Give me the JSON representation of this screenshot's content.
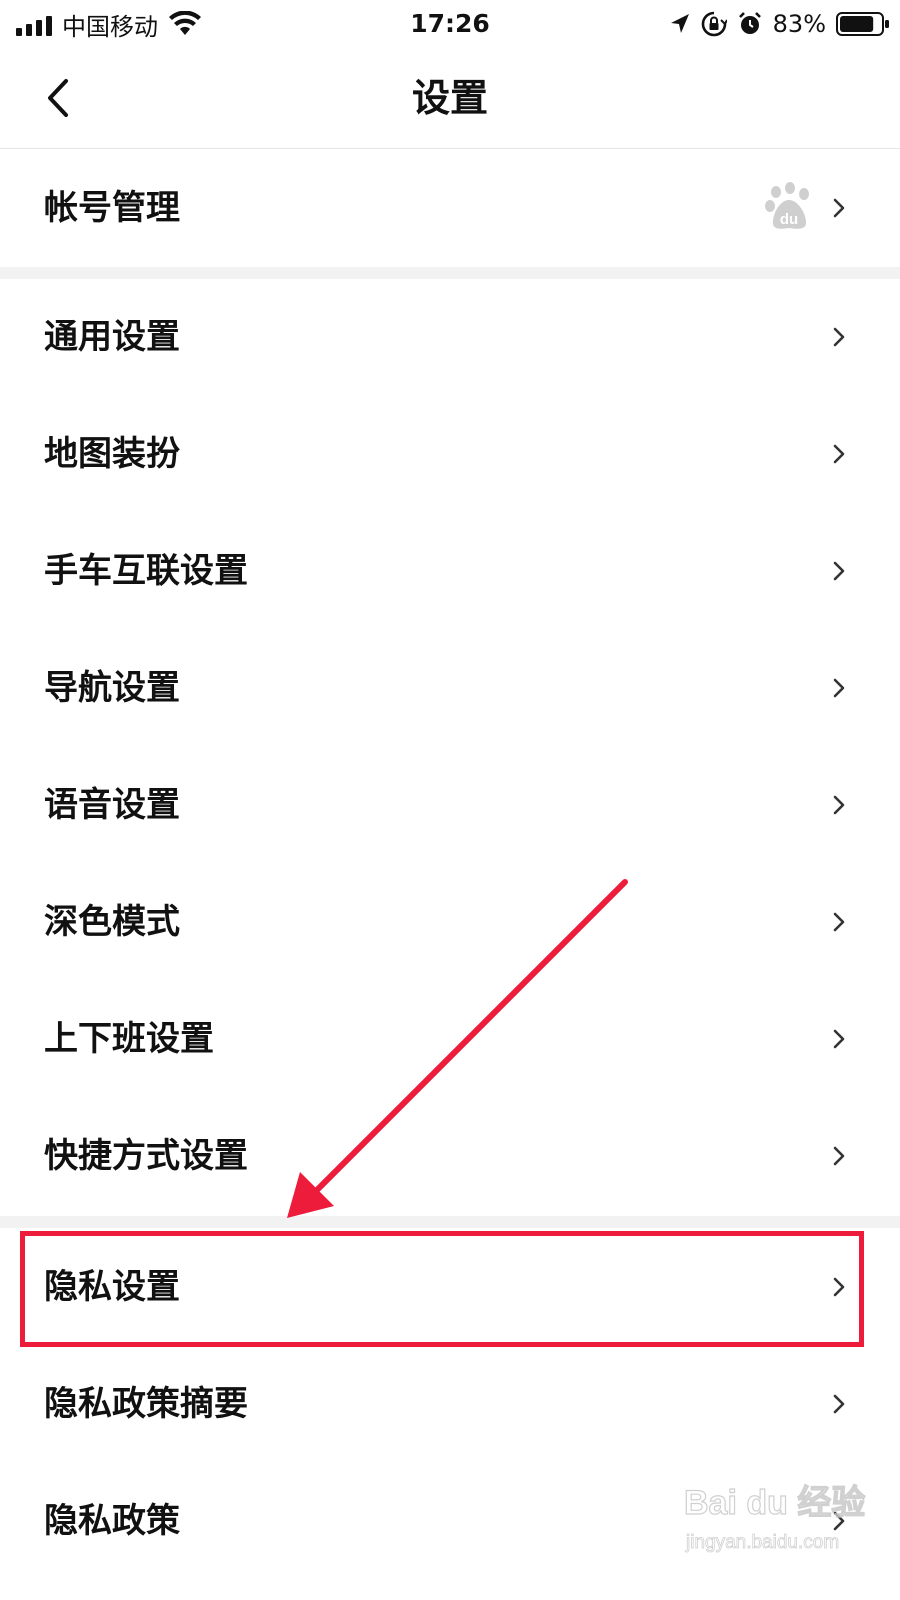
{
  "status_bar": {
    "carrier": "中国移动",
    "time": "17:26",
    "battery_percent": "83%",
    "battery_level": 0.83,
    "icons": [
      "signal-icon",
      "wifi-icon",
      "location-icon",
      "rotation-lock-icon",
      "alarm-icon",
      "battery-icon"
    ]
  },
  "nav": {
    "title": "设置",
    "back_icon": "chevron-left-icon"
  },
  "account": {
    "label": "帐号管理",
    "logo": "baidu-paw-logo",
    "logo_text": "du"
  },
  "group1": [
    {
      "label": "通用设置"
    },
    {
      "label": "地图装扮"
    },
    {
      "label": "手车互联设置"
    },
    {
      "label": "导航设置"
    },
    {
      "label": "语音设置"
    },
    {
      "label": "深色模式"
    },
    {
      "label": "上下班设置"
    },
    {
      "label": "快捷方式设置"
    }
  ],
  "group2": [
    {
      "label": "隐私设置",
      "highlighted": true
    },
    {
      "label": "隐私政策摘要"
    },
    {
      "label": "隐私政策"
    }
  ],
  "annotation": {
    "highlight_color": "#ec1c3a",
    "arrow_color": "#ec1c3a"
  },
  "watermark": {
    "brand": "Bai du 经验",
    "url": "jingyan.baidu.com"
  }
}
